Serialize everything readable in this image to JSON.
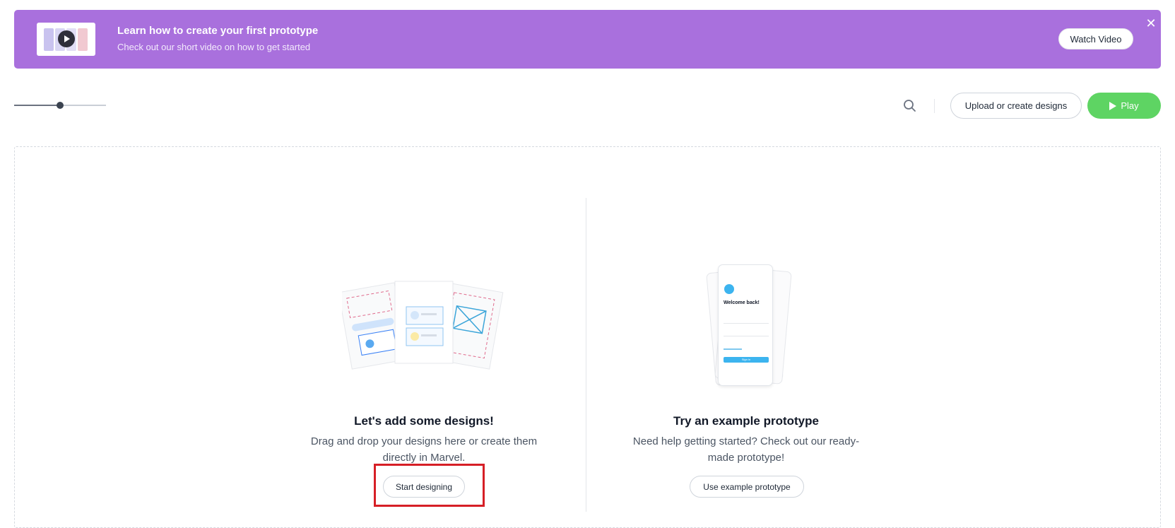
{
  "banner": {
    "title": "Learn how to create your first prototype",
    "subtitle": "Check out our short video on how to get started",
    "watch_label": "Watch Video",
    "close_glyph": "✕",
    "color": "#a970dd"
  },
  "toolbar": {
    "zoom_level": 0.5,
    "search_icon": "search-icon",
    "upload_label": "Upload or create designs",
    "play_label": "Play",
    "play_color": "#5ed463"
  },
  "empty_state": {
    "designs": {
      "title": "Let's add some designs!",
      "description": "Drag and drop your designs here or create them directly in Marvel.",
      "button_label": "Start designing"
    },
    "example": {
      "title": "Try an example prototype",
      "description": "Need help getting started? Check out our ready-made prototype!",
      "button_label": "Use example prototype",
      "phone_heading": "Welcome back!",
      "phone_button": "Sign in"
    }
  },
  "highlight_color": "#d61f26"
}
